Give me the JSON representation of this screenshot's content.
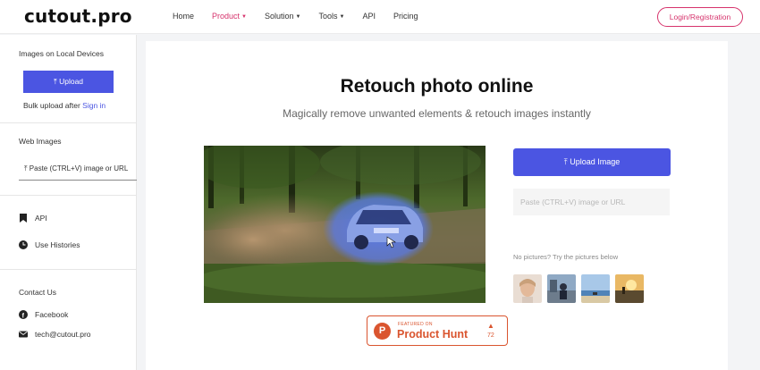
{
  "header": {
    "logo": "cutout.pro",
    "nav": [
      {
        "label": "Home",
        "caret": ""
      },
      {
        "label": "Product",
        "caret": "▼"
      },
      {
        "label": "Solution",
        "caret": "▼"
      },
      {
        "label": "Tools",
        "caret": "▼"
      },
      {
        "label": "API",
        "caret": ""
      },
      {
        "label": "Pricing",
        "caret": ""
      }
    ],
    "login_label": "Login/Registration",
    "accent_color": "#d6336c"
  },
  "sidebar": {
    "local_title": "Images on Local Devices",
    "upload_label": "Upload",
    "bulk_text": "Bulk upload after ",
    "sign_in": "Sign in",
    "web_title": "Web Images",
    "paste_label": "Paste (CTRL+V) image or URL",
    "api_label": "API",
    "history_label": "Use Histories",
    "contact_title": "Contact Us",
    "facebook_label": "Facebook",
    "email_label": "tech@cutout.pro"
  },
  "main": {
    "title": "Retouch photo online",
    "subtitle": "Magically remove unwanted elements & retouch images instantly",
    "upload_image_label": "Upload Image",
    "paste_placeholder": "Paste (CTRL+V) image or URL",
    "no_pictures": "No pictures? Try the pictures below",
    "primary_color": "#4b55e2"
  },
  "product_hunt": {
    "featured": "FEATURED ON",
    "name": "Product Hunt",
    "count": "72",
    "color": "#da552f"
  }
}
